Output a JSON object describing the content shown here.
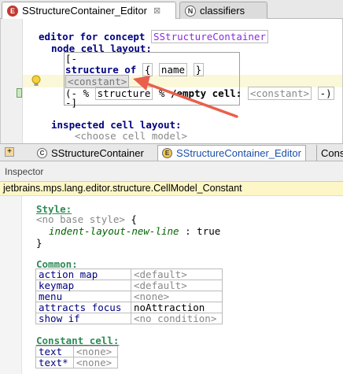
{
  "top_tabs": [
    {
      "label": "SStructureContainer_Editor",
      "icon": "editor-icon",
      "active": true,
      "close": "⊠"
    },
    {
      "label": "classifiers",
      "icon": "N",
      "active": false
    }
  ],
  "editor": {
    "line_editor_for": "editor for concept",
    "concept_name": "SStructureContainer",
    "line_node_cell_layout": "node cell layout:",
    "open_bracket": "[-",
    "structure_kw": "structure",
    "of_kw": "of",
    "brace_open": "{",
    "name_field": "name",
    "brace_close": "}",
    "constant_cell": "<constant>",
    "row4_open": "(- %",
    "row4_structure": "structure",
    "row4_pct": "%",
    "row4_empty": "/empty cell:",
    "row4_constant": "<constant>",
    "row4_close": "-)",
    "close_bracket": "-]",
    "line_inspected": "inspected cell layout:",
    "choose_cell_model": "<choose cell model>"
  },
  "editor_tabs": [
    {
      "label": "SStructureContainer",
      "icon": "C"
    },
    {
      "label": "SStructureContainer_Editor",
      "icon": "E"
    },
    {
      "label": "Cons"
    }
  ],
  "inspector": {
    "title": "Inspector",
    "fqn": "jetbrains.mps.lang.editor.structure.CellModel_Constant",
    "style_header": "Style:",
    "no_base_style": "<no base style>",
    "brace_open": "{",
    "style_prop": "indent-layout-new-line",
    "style_colon": ":",
    "style_value": "true",
    "brace_close": "}",
    "common_header": "Common:",
    "common_rows": [
      {
        "name": "action map",
        "value": "<default>"
      },
      {
        "name": "keymap",
        "value": "<default>"
      },
      {
        "name": "menu",
        "value": "<none>"
      },
      {
        "name": "attracts focus",
        "value": "noAttraction"
      },
      {
        "name": "show if",
        "value": "<no condition>"
      }
    ],
    "constant_header": "Constant cell:",
    "constant_rows": [
      {
        "name": "text",
        "value": "<none>"
      },
      {
        "name": "text*",
        "value": "<none>"
      }
    ]
  },
  "colors": {
    "arrow": "#e8604c",
    "highlight": "#fdf6c7"
  }
}
